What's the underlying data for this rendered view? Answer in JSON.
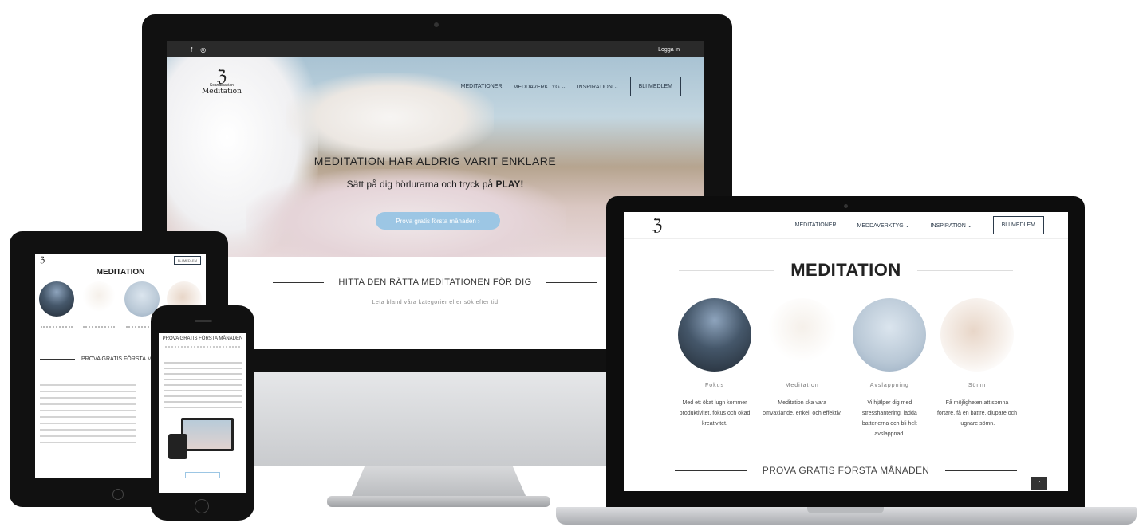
{
  "desktop": {
    "topbar": {
      "facebook_icon": "f",
      "instagram_icon": "◎",
      "login": "Logga in"
    },
    "logo": {
      "mark": "ℨ",
      "small": "Scandinavian",
      "big": "Meditation"
    },
    "nav": {
      "meditationer": "MEDITATIONER",
      "meddverktyg": "MEDDAVERKTYG ⌄",
      "inspiration": "INSPIRATION ⌄",
      "bli_medlem": "BLI MEDLEM"
    },
    "hero": {
      "title": "MEDITATION HAR ALDRIG VARIT ENKLARE",
      "subtitle_prefix": "Sätt på dig hörlurarna och tryck på ",
      "subtitle_emph": "PLAY!",
      "button": "Prova gratis första månaden ›"
    },
    "find": {
      "title": "HITTA DEN RÄTTA MEDITATIONEN FÖR DIG",
      "subtitle": "Leta bland våra kategorier el er sök efter tid"
    }
  },
  "laptop": {
    "logo_mark": "ℨ",
    "nav": {
      "meditationer": "MEDITATIONER",
      "meddverktyg": "MEDDAVERKTYG ⌄",
      "inspiration": "INSPIRATION ⌄",
      "bli_medlem": "BLI MEDLEM"
    },
    "title": "MEDITATION",
    "categories": [
      {
        "name": "Fokus",
        "desc": "Med ett ökat lugn kommer produktivitet, fokus och ökad kreativitet."
      },
      {
        "name": "Meditation",
        "desc": "Meditation ska vara omväxlande, enkel, och effektiv."
      },
      {
        "name": "Avslappning",
        "desc": "Vi hjälper dig med stresshantering, ladda batterierna och bli helt avslappnad."
      },
      {
        "name": "Sömn",
        "desc": "Få möjligheten att somna fortare, få en bättre, djupare och lugnare sömn."
      }
    ],
    "prova": "PROVA GRATIS FÖRSTA MÅNADEN",
    "scroll_top": "⌃"
  },
  "ipad": {
    "logo_mark": "ℨ",
    "cta": "BLI MEDLEM",
    "title": "MEDITATION",
    "prova": "PROVA GRATIS FÖRSTA MÅNADEN"
  },
  "iphone": {
    "title": "PROVA GRATIS FÖRSTA MÅNADEN"
  },
  "apple_logo": ""
}
